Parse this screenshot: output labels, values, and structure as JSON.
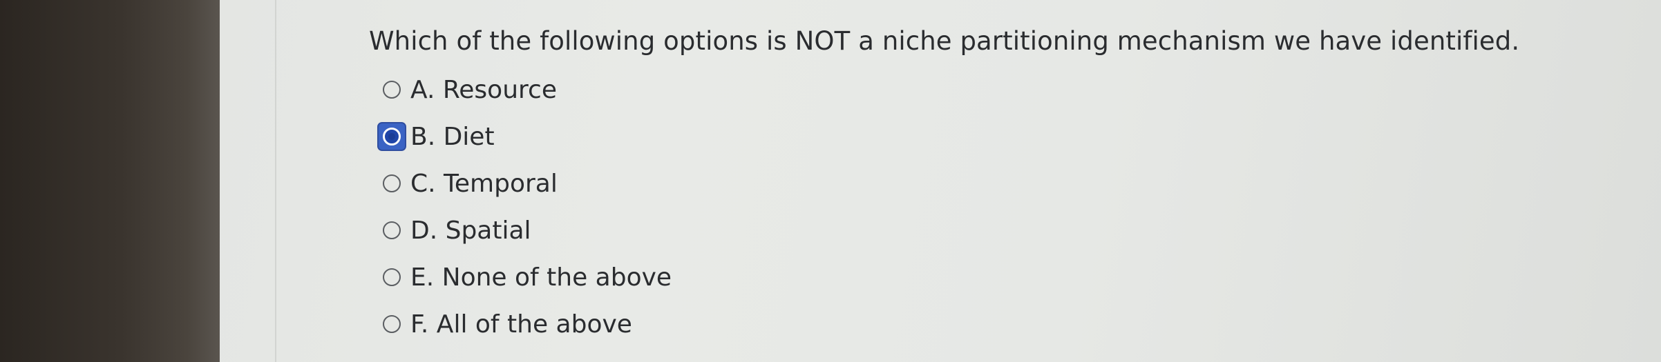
{
  "question": {
    "text": "Which of the following options is NOT a niche partitioning mechanism we have identified."
  },
  "options": [
    {
      "label": "A. Resource",
      "selected": false
    },
    {
      "label": "B. Diet",
      "selected": true
    },
    {
      "label": "C. Temporal",
      "selected": false
    },
    {
      "label": "D. Spatial",
      "selected": false
    },
    {
      "label": "E. None of the above",
      "selected": false
    },
    {
      "label": "F. All of the above",
      "selected": false
    }
  ],
  "colors": {
    "selected_radio": "#3a63c4",
    "text": "#2a2c2f",
    "background": "#e6e8e5"
  },
  "icons": {
    "radio": "radio-button-icon"
  }
}
